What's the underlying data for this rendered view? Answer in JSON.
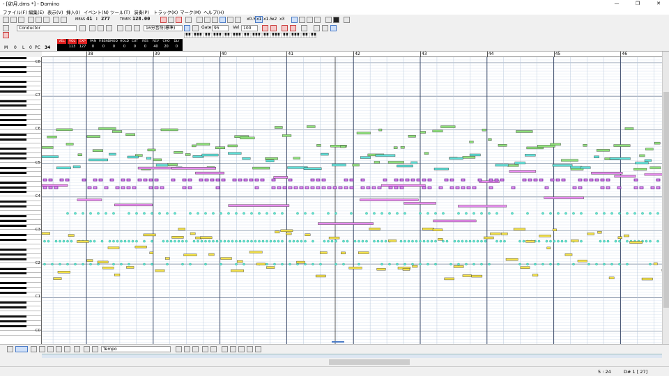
{
  "window": {
    "title": "- [卯月.dms *] - Domino",
    "controls": [
      "—",
      "❐",
      "✕"
    ]
  },
  "menu": [
    "ファイル(F)",
    "編集(E)",
    "表示(V)",
    "挿入(I)",
    "イベント(N)",
    "ツール(T)",
    "演奏(P)",
    "トラック(K)",
    "マーク(M)",
    "ヘルプ(H)"
  ],
  "toolbar": {
    "meas_label": "MEAS",
    "meas_value": "41 : 277",
    "tempo_label": "TEMPO",
    "tempo_value": "128.00",
    "speed_buttons": [
      "x0.5",
      "x1",
      "x1.5",
      "x2",
      "x3"
    ],
    "track_select": "Conductor",
    "note_length": "16th 標準Hz",
    "note_length_label": "16分音符(標準)",
    "gate_label": "Gate",
    "gate_value": "95",
    "vel_label": "Vel",
    "vel_value": "100"
  },
  "infobar": {
    "m_label": "M",
    "m_value": "0",
    "l_label": "L",
    "l_value": "0",
    "pc_label": "PC",
    "pc_value": "34",
    "columns": [
      {
        "h": "VEL",
        "v": "",
        "hl": true
      },
      {
        "h": "VOL",
        "v": "113",
        "hl": true
      },
      {
        "h": "EXP",
        "v": "127",
        "hl": true
      },
      {
        "h": "PAN",
        "v": "0",
        "hl": false
      },
      {
        "h": "P.BEND",
        "v": "0",
        "hl": false
      },
      {
        "h": "MOD",
        "v": "0",
        "hl": false
      },
      {
        "h": "HOLD",
        "v": "0",
        "hl": false
      },
      {
        "h": "CUT",
        "v": "0",
        "hl": false
      },
      {
        "h": "RES",
        "v": "0",
        "hl": false
      },
      {
        "h": "REV",
        "v": "40",
        "hl": false
      },
      {
        "h": "CHO",
        "v": "20",
        "hl": false
      },
      {
        "h": "DLY",
        "v": "0",
        "hl": false
      }
    ]
  },
  "ruler": {
    "bars": [
      "38",
      "39",
      "40",
      "41",
      "42",
      "43",
      "44",
      "45",
      "46"
    ]
  },
  "octaves": [
    "C8",
    "C7",
    "C6",
    "C5",
    "C4",
    "C3",
    "C2",
    "C1",
    "C0"
  ],
  "colors": {
    "green": "#8ee07a",
    "cyan": "#5fe0d8",
    "pink": "#e98cf0",
    "yellow": "#f4e24a",
    "purple": "#6b2c9e",
    "red": "#e02020"
  },
  "bottom": {
    "event_select": "Tempo"
  },
  "status": {
    "position": "5 : 24",
    "note": "D# 1 [ 27]"
  }
}
